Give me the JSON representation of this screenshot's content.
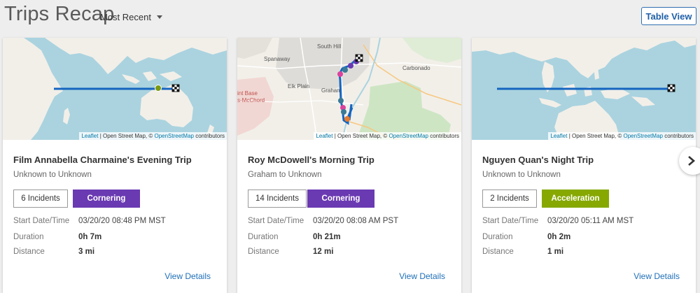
{
  "header": {
    "title": "Trips Recap",
    "sort_label": "Most Recent",
    "table_view_label": "Table View"
  },
  "attribution": {
    "leaflet": "Leaflet",
    "separator": " | Open Street Map, © ",
    "osm": "OpenStreetMap",
    "suffix": " contributors"
  },
  "labels": {
    "start": "Start Date/Time",
    "duration": "Duration",
    "distance": "Distance",
    "view_details": "View Details"
  },
  "map2_places": {
    "south_hill": "South Hill",
    "spanaway": "Spanaway",
    "carbonado": "Carbonado",
    "elk_plain": "Elk Plain",
    "graham": "Graham",
    "base1": "int Base",
    "base2": "s-McChord"
  },
  "trips": [
    {
      "title": "Film Annabella Charmaine's Evening Trip",
      "route": "Unknown to Unknown",
      "incidents": "6 Incidents",
      "type": "Cornering",
      "type_color": "#6a3ab2",
      "start": "03/20/20 08:48 PM MST",
      "duration": "0h 7m",
      "distance": "3 mi"
    },
    {
      "title": "Roy McDowell's Morning Trip",
      "route": "Graham to Unknown",
      "incidents": "14 Incidents",
      "type": "Cornering",
      "type_color": "#6a3ab2",
      "start": "03/20/20 08:08 AM PST",
      "duration": "0h 21m",
      "distance": "12 mi"
    },
    {
      "title": "Nguyen Quan's Night Trip",
      "route": "Unknown to Unknown",
      "incidents": "2 Incidents",
      "type": "Acceleration",
      "type_color": "#86a800",
      "start": "03/20/20 05:11 AM MST",
      "duration": "0h 2m",
      "distance": "1 mi"
    }
  ],
  "colors": {
    "route": "#1565c0",
    "link": "#1f6fb8",
    "water": "#aad3df",
    "land": "#f2efe9"
  }
}
